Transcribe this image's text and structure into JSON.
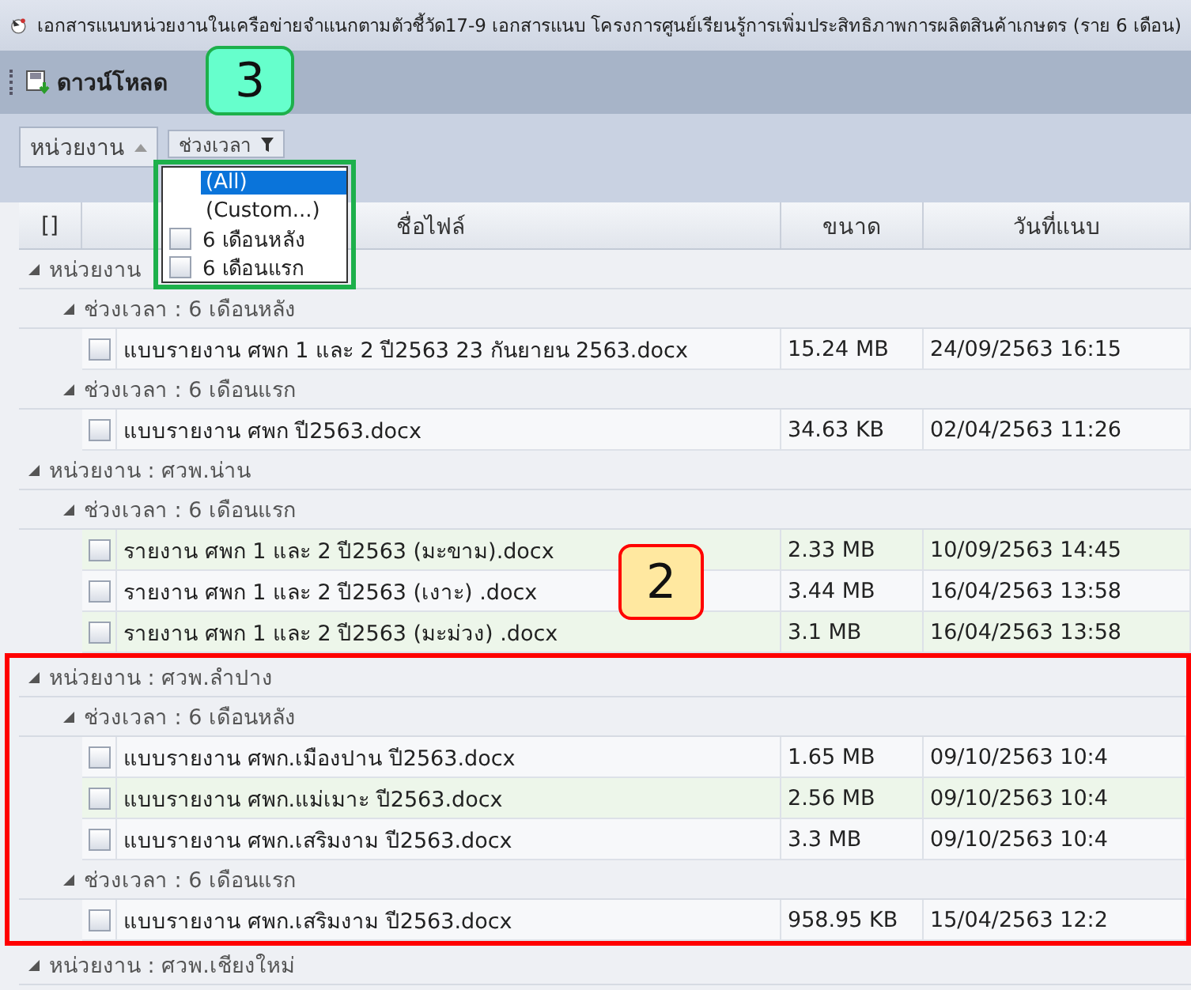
{
  "window": {
    "title": "เอกสารแนบหน่วยงานในเครือข่ายจำแนกตามตัวชี้วัด17-9 เอกสารแนบ โครงการศูนย์เรียนรู้การเพิ่มประสิทธิภาพการผลิตสินค้าเกษตร (ราย 6 เดือน)"
  },
  "toolbar": {
    "download_button": "ดาวน์โหลด"
  },
  "group_panel": {
    "chips": [
      "หน่วยงาน",
      "ช่วงเวลา"
    ]
  },
  "filter_popup": {
    "items": [
      {
        "label": "(All)",
        "kind": "option",
        "selected": true
      },
      {
        "label": "(Custom...)",
        "kind": "option",
        "selected": false
      },
      {
        "label": "6 เดือนหลัง",
        "kind": "checkbox",
        "checked": false
      },
      {
        "label": "6 เดือนแรก",
        "kind": "checkbox",
        "checked": false
      }
    ],
    "callout": {
      "label": "3",
      "color": "#1db04b"
    }
  },
  "table": {
    "columns": [
      "[]",
      "ชื่อไฟล์",
      "ขนาด",
      "วันที่แนบ"
    ],
    "groups": [
      {
        "label": "หน่วยงาน",
        "expanded": true,
        "children": [
          {
            "label": "ช่วงเวลา : 6 เดือนหลัง",
            "expanded": true,
            "rows": [
              {
                "checked": false,
                "highlighted": false,
                "name": "แบบรายงาน ศพก 1 และ 2  ปี2563 23 กันยายน 2563.docx",
                "size": "15.24 MB",
                "date": "24/09/2563 16:15"
              }
            ]
          },
          {
            "label": "ช่วงเวลา : 6 เดือนแรก",
            "expanded": true,
            "rows": [
              {
                "checked": false,
                "highlighted": false,
                "name": "แบบรายงาน ศพก ปี2563.docx",
                "size": "34.63 KB",
                "date": "02/04/2563 11:26"
              }
            ]
          }
        ]
      },
      {
        "label": "หน่วยงาน : ศวพ.น่าน",
        "expanded": true,
        "children": [
          {
            "label": "ช่วงเวลา : 6 เดือนแรก",
            "expanded": true,
            "rows": [
              {
                "checked": false,
                "highlighted": true,
                "name": "รายงาน ศพก 1 และ 2  ปี2563 (มะขาม).docx",
                "size": "2.33 MB",
                "date": "10/09/2563 14:45"
              },
              {
                "checked": false,
                "highlighted": false,
                "name": "รายงาน ศพก 1 และ 2  ปี2563 (เงาะ) .docx",
                "size": "3.44 MB",
                "date": "16/04/2563 13:58"
              },
              {
                "checked": false,
                "highlighted": true,
                "name": "รายงาน ศพก 1 และ 2  ปี2563 (มะม่วง) .docx",
                "size": "3.1 MB",
                "date": "16/04/2563 13:58"
              }
            ]
          }
        ]
      },
      {
        "label": "หน่วยงาน : ศวพ.ลำปาง",
        "expanded": true,
        "callout": {
          "label": "2",
          "color": "#ff0000"
        },
        "children": [
          {
            "label": "ช่วงเวลา : 6 เดือนหลัง",
            "expanded": true,
            "rows": [
              {
                "checked": false,
                "highlighted": false,
                "name": "แบบรายงาน ศพก.เมืองปาน ปี2563.docx",
                "size": "1.65 MB",
                "date": "09/10/2563 10:4"
              },
              {
                "checked": false,
                "highlighted": true,
                "name": "แบบรายงาน ศพก.แม่เมาะ ปี2563.docx",
                "size": "2.56 MB",
                "date": "09/10/2563 10:4"
              },
              {
                "checked": false,
                "highlighted": false,
                "name": "แบบรายงาน ศพก.เสริมงาม ปี2563.docx",
                "size": "3.3 MB",
                "date": "09/10/2563 10:4"
              }
            ]
          },
          {
            "label": "ช่วงเวลา : 6 เดือนแรก",
            "expanded": true,
            "rows": [
              {
                "checked": false,
                "highlighted": false,
                "name": "แบบรายงาน ศพก.เสริมงาม ปี2563.docx",
                "size": "958.95 KB",
                "date": "15/04/2563 12:2"
              }
            ]
          }
        ]
      },
      {
        "label": "หน่วยงาน : ศวพ.เชียงใหม่",
        "expanded": true
      }
    ]
  }
}
